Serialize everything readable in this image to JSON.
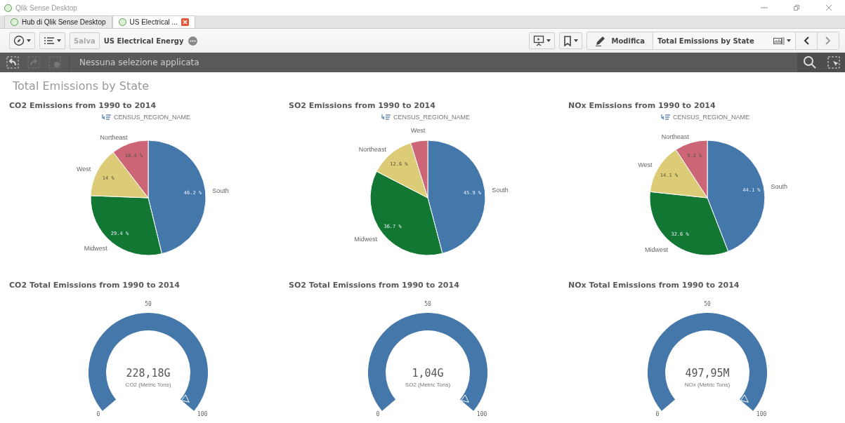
{
  "window": {
    "title": "Qlik Sense Desktop"
  },
  "tabs": [
    {
      "label": "Hub di Qlik Sense Desktop",
      "selected": false
    },
    {
      "label": "US Electrical ...",
      "selected": true
    }
  ],
  "toolbar": {
    "save_label": "Salva",
    "save_disabled": true,
    "app_title": "US Electrical Energy",
    "edit_label": "Modifica",
    "sheet_title": "Total Emissions by State"
  },
  "selection_bar": {
    "text": "Nessuna selezione applicata"
  },
  "sheet": {
    "title": "Total Emissions by State"
  },
  "pies": [
    {
      "title": "CO2 Emissions from 1990 to 2014",
      "legend": "CENSUS_REGION_NAME",
      "chart_data": {
        "type": "pie",
        "categories": [
          "South",
          "Midwest",
          "West",
          "Northeast"
        ],
        "values": [
          46.2,
          29.4,
          14,
          10.4
        ],
        "value_labels": [
          "46.2 %",
          "29.4 %",
          "14 %",
          "10.4 %"
        ]
      }
    },
    {
      "title": "SO2 Emissions from 1990 to 2014",
      "legend": "CENSUS_REGION_NAME",
      "chart_data": {
        "type": "pie",
        "categories": [
          "South",
          "Midwest",
          "Northeast",
          "West"
        ],
        "values": [
          45.9,
          36.7,
          12.6,
          4.8
        ],
        "value_labels": [
          "45.9 %",
          "36.7 %",
          "12.6 %",
          null
        ]
      }
    },
    {
      "title": "NOx Emissions from 1990 to 2014",
      "legend": "CENSUS_REGION_NAME",
      "chart_data": {
        "type": "pie",
        "categories": [
          "South",
          "Midwest",
          "West",
          "Northeast"
        ],
        "values": [
          44.1,
          32.6,
          14.1,
          9.2
        ],
        "value_labels": [
          "44.1 %",
          "32.6 %",
          "14.1 %",
          "9.2 %"
        ]
      }
    }
  ],
  "gauges": [
    {
      "title": "CO2 Total Emissions from 1990 to 2014",
      "value": "228,18G",
      "label": "CO2 (Metric Tons)",
      "level": 1,
      "ticks": [
        "0",
        "50",
        "100"
      ]
    },
    {
      "title": "SO2 Total Emissions from 1990 to 2014",
      "value": "1,04G",
      "label": "SO2 (Metric Tons)",
      "level": 1,
      "ticks": [
        "0",
        "50",
        "100"
      ]
    },
    {
      "title": "NOx Total Emissions from 1990 to 2014",
      "value": "497,95M",
      "label": "NOx (Metric Tons)",
      "level": 1,
      "ticks": [
        "0",
        "50",
        "100"
      ]
    }
  ]
}
